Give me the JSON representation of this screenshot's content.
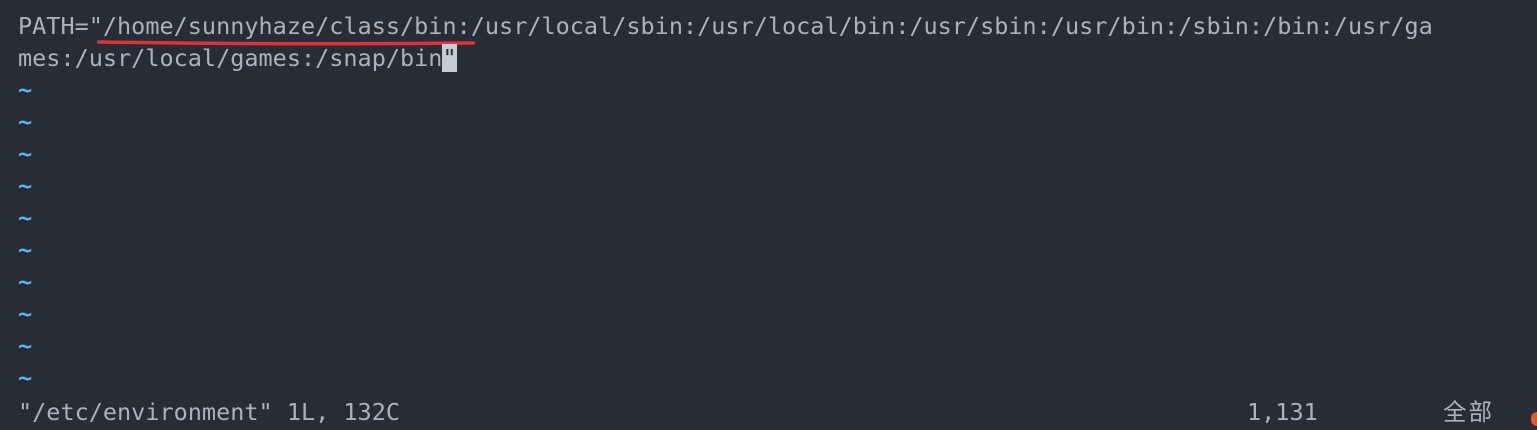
{
  "editor": {
    "buffer": {
      "line1": {
        "prefix": "PATH=\"",
        "highlighted": "/home/sunnyhaze/class/bin:",
        "rest": "/usr/local/sbin:/usr/local/bin:/usr/sbin:/usr/bin:/sbin:/bin:/usr/ga"
      },
      "line2": {
        "text": "mes:/usr/local/games:/snap/bin",
        "cursor_char": "\""
      },
      "empty_line_marker": "~",
      "empty_line_count": 10
    },
    "status_bar": {
      "file_info": "\"/etc/environment\" 1L, 132C",
      "cursor_position": "1,131",
      "scroll_position": "全部"
    },
    "colors": {
      "background": "#282c34",
      "text": "#abb2bf",
      "tilde": "#61afef",
      "annotation_underline": "#e0303a",
      "cursor": "#c7ccd4"
    }
  }
}
